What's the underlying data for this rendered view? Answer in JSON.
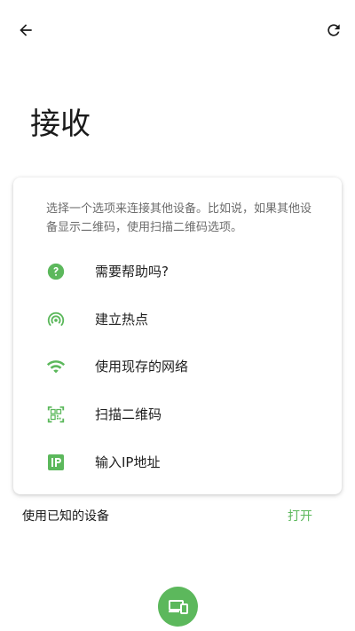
{
  "header": {
    "back_icon": "arrow-back-icon",
    "refresh_icon": "refresh-icon"
  },
  "title": "接收",
  "card": {
    "description": "选择一个选项来连接其他设备。比如说，如果其他设备显示二维码，使用扫描二维码选项。",
    "options": [
      {
        "label": "需要帮助吗?",
        "icon": "help-circle-icon"
      },
      {
        "label": "建立热点",
        "icon": "hotspot-icon"
      },
      {
        "label": "使用现存的网络",
        "icon": "wifi-icon"
      },
      {
        "label": "扫描二维码",
        "icon": "qr-scan-icon"
      },
      {
        "label": "输入IP地址",
        "icon": "ip-icon"
      }
    ]
  },
  "known_devices": {
    "label": "使用已知的设备",
    "action": "打开"
  },
  "fab": {
    "icon": "devices-icon"
  },
  "colors": {
    "accent": "#5cb85c",
    "text": "#1e1e1e",
    "secondary_text": "#6c6c6c",
    "background": "#ffffff"
  }
}
